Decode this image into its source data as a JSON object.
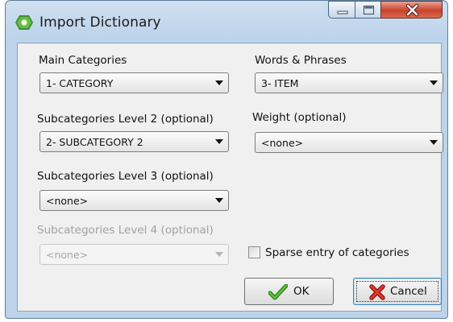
{
  "window": {
    "title": "Import Dictionary",
    "controls": {
      "minimize": "minimize",
      "maximize": "maximize",
      "close": "close"
    }
  },
  "fields": {
    "main_categories": {
      "label": "Main Categories",
      "value": "1- CATEGORY",
      "enabled": true
    },
    "subcat2": {
      "label": "Subcategories Level 2 (optional)",
      "value": "2- SUBCATEGORY 2",
      "enabled": true
    },
    "subcat3": {
      "label": "Subcategories Level 3 (optional)",
      "value": "<none>",
      "enabled": true
    },
    "subcat4": {
      "label": "Subcategories Level 4 (optional)",
      "value": "<none>",
      "enabled": false
    },
    "words": {
      "label": "Words & Phrases",
      "value": "3- ITEM",
      "enabled": true
    },
    "weight": {
      "label": "Weight (optional)",
      "value": "<none>",
      "enabled": true
    }
  },
  "sparse": {
    "label": "Sparse entry of categories",
    "checked": false
  },
  "buttons": {
    "ok": "OK",
    "cancel": "Cancel"
  },
  "icons": {
    "app": "app-icon",
    "dropdown": "chevron-down-icon",
    "ok": "checkmark-icon",
    "cancel": "x-icon"
  },
  "colors": {
    "title_bar": "#bcd3ea",
    "close_button": "#c9422b",
    "ok_check": "#3b9a1f",
    "cancel_x": "#c8231c"
  }
}
